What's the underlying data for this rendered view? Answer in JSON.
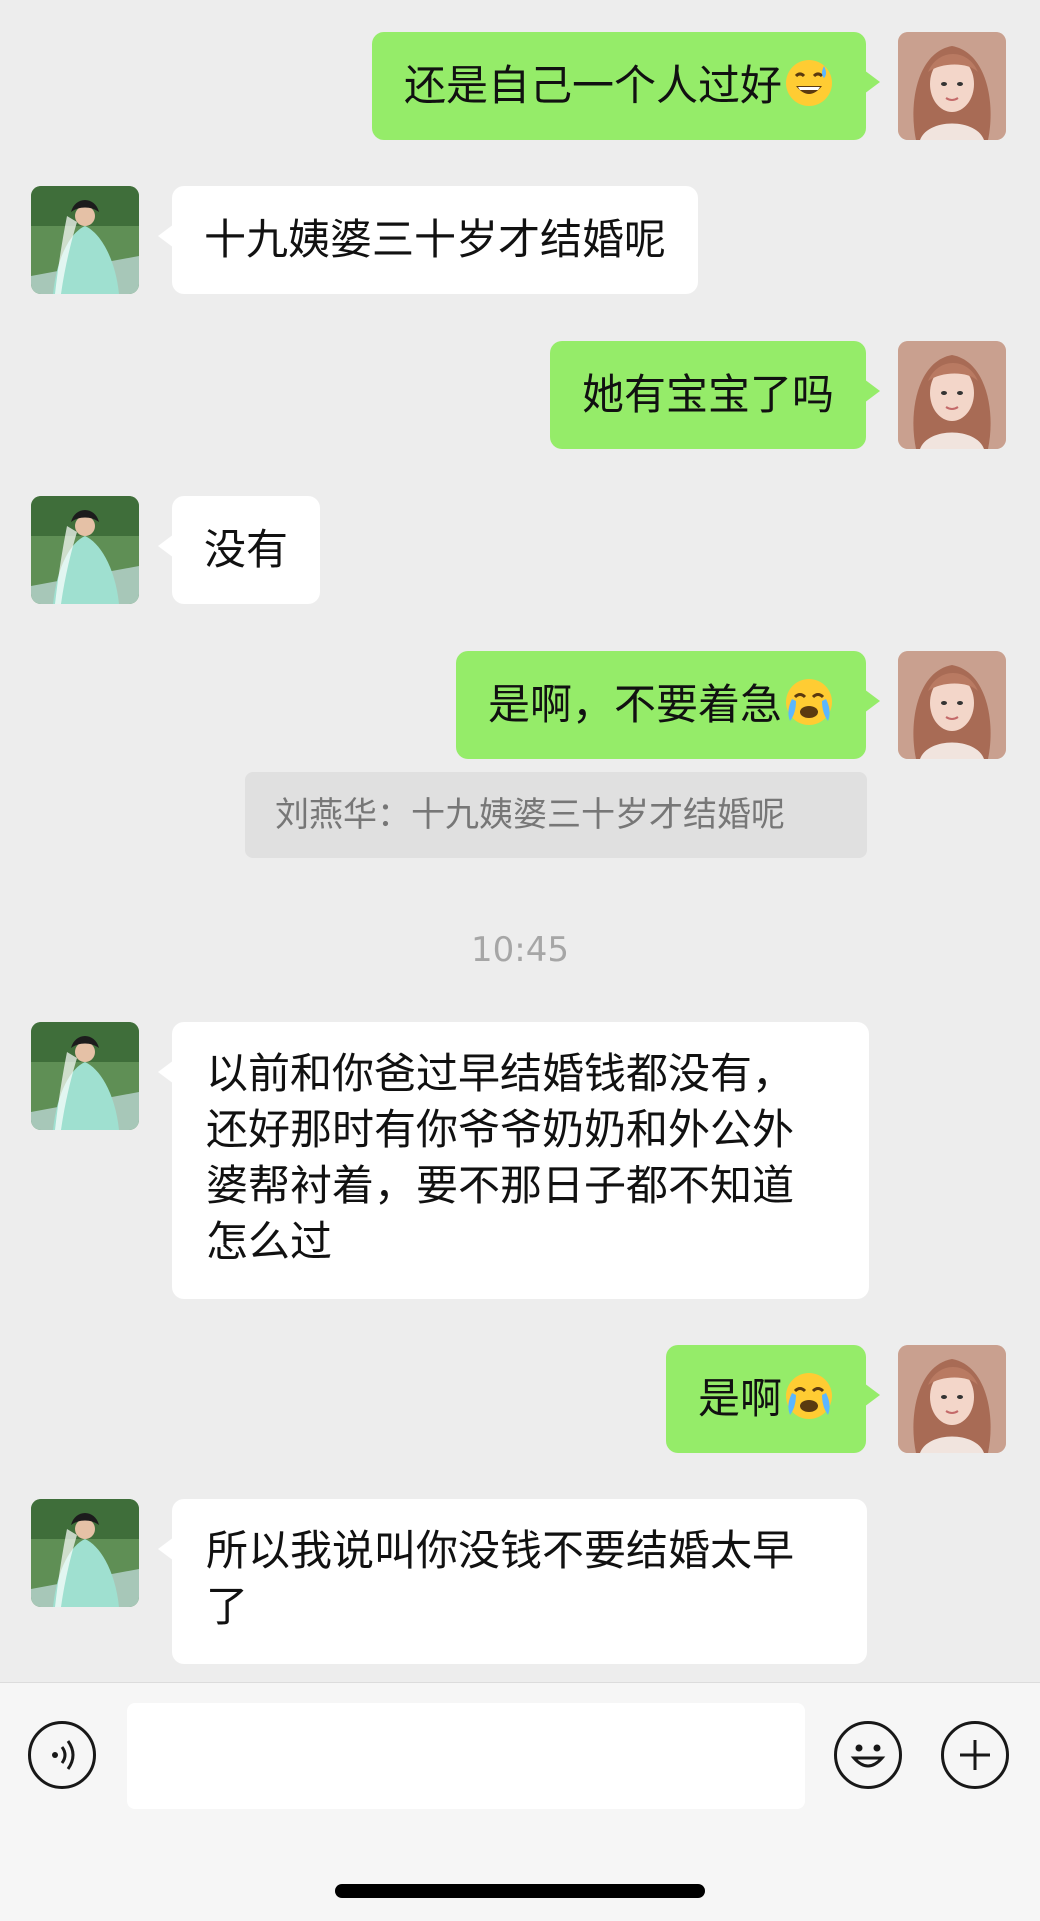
{
  "messages": [
    {
      "side": "right",
      "text": "还是自己一个人过好",
      "emoji": "grinning-sweat-emoji"
    },
    {
      "side": "left",
      "text": "十九姨婆三十岁才结婚呢"
    },
    {
      "side": "right",
      "text": "她有宝宝了吗"
    },
    {
      "side": "left",
      "text": "没有"
    },
    {
      "side": "right",
      "text": "是啊，不要着急",
      "emoji": "loudly-crying-emoji"
    },
    {
      "side": "left",
      "text": "以前和你爸过早结婚钱都没有，还好那时有你爷爷奶奶和外公外婆帮衬着，要不那日子都不知道怎么过"
    },
    {
      "side": "right",
      "text": "是啊",
      "emoji": "loudly-crying-emoji"
    },
    {
      "side": "left",
      "text": "所以我说叫你没钱不要结婚太早了"
    }
  ],
  "quote": {
    "text": "刘燕华：十九姨婆三十岁才结婚呢"
  },
  "timestamp": "10:45",
  "input_bar": {
    "voice_icon": "voice-icon",
    "emoji_icon": "smiley-icon",
    "plus_icon": "plus-icon",
    "placeholder": ""
  },
  "colors": {
    "green_bubble": "#95ec69",
    "white_bubble": "#ffffff",
    "background": "#ededed"
  }
}
